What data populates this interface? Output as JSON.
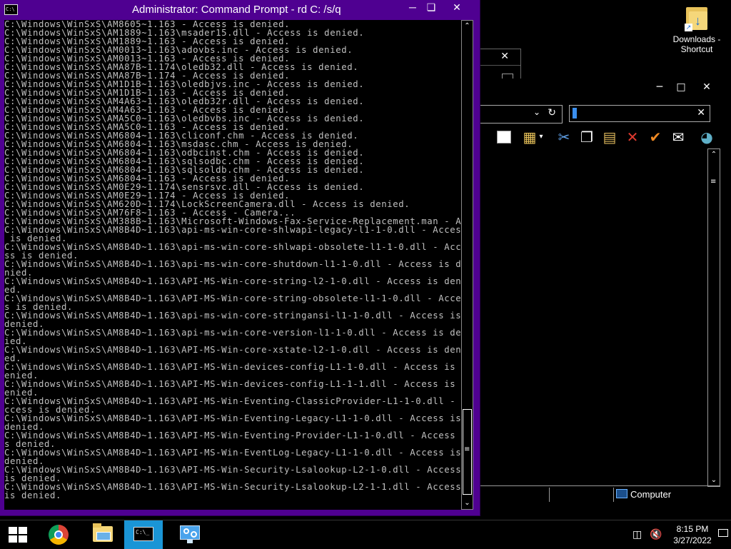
{
  "desktop": {
    "shortcut_label": "Downloads - Shortcut"
  },
  "cmd": {
    "title": "Administrator: Command Prompt - rd  C: /s/q",
    "app_icon_text": "C:\\",
    "lines": [
      "C:\\Windows\\WinSxS\\AM8605~1.163 - Access is denied.",
      "C:\\Windows\\WinSxS\\AM1889~1.163\\msader15.dll - Access is denied.",
      "C:\\Windows\\WinSxS\\AM1889~1.163 - Access is denied.",
      "C:\\Windows\\WinSxS\\AM0013~1.163\\adovbs.inc - Access is denied.",
      "C:\\Windows\\WinSxS\\AM0013~1.163 - Access is denied.",
      "C:\\Windows\\WinSxS\\AMA87B~1.174\\oledb32.dll - Access is denied.",
      "C:\\Windows\\WinSxS\\AMA87B~1.174 - Access is denied.",
      "C:\\Windows\\WinSxS\\AM1D1B~1.163\\oledbjvs.inc - Access is denied.",
      "C:\\Windows\\WinSxS\\AM1D1B~1.163 - Access is denied.",
      "C:\\Windows\\WinSxS\\AM4A63~1.163\\oledb32r.dll - Access is denied.",
      "C:\\Windows\\WinSxS\\AM4A63~1.163 - Access is denied.",
      "C:\\Windows\\WinSxS\\AMA5C0~1.163\\oledbvbs.inc - Access is denied.",
      "C:\\Windows\\WinSxS\\AMA5C0~1.163 - Access is denied.",
      "C:\\Windows\\WinSxS\\AM6804~1.163\\cliconf.chm - Access is denied.",
      "C:\\Windows\\WinSxS\\AM6804~1.163\\msdasc.chm - Access is denied.",
      "C:\\Windows\\WinSxS\\AM6804~1.163\\odbcinst.chm - Access is denied.",
      "C:\\Windows\\WinSxS\\AM6804~1.163\\sqlsodbc.chm - Access is denied.",
      "C:\\Windows\\WinSxS\\AM6804~1.163\\sqlsoldb.chm - Access is denied.",
      "C:\\Windows\\WinSxS\\AM6804~1.163 - Access is denied.",
      "C:\\Windows\\WinSxS\\AM0E29~1.174\\sensrsvc.dll - Access is denied.",
      "C:\\Windows\\WinSxS\\AM0E29~1.174 - Access is denied.",
      "C:\\Windows\\WinSxS\\AM620D~1.174\\LockScreenCamera.dll - Access is denied.",
      "C:\\Windows\\WinSxS\\AM76F8~1.163 - Access - Camera...",
      "C:\\Windows\\WinSxS\\AM388B~1.163\\Microsoft-Windows-Fax-Service-Replacement.man - Ac",
      "C:\\Windows\\WinSxS\\AM8B4D~1.163\\api-ms-win-core-shlwapi-legacy-l1-1-0.dll - Access",
      " is denied.",
      "C:\\Windows\\WinSxS\\AM8B4D~1.163\\api-ms-win-core-shlwapi-obsolete-l1-1-0.dll - Acce",
      "ss is denied.",
      "C:\\Windows\\WinSxS\\AM8B4D~1.163\\api-ms-win-core-shutdown-l1-1-0.dll - Access is de",
      "nied.",
      "C:\\Windows\\WinSxS\\AM8B4D~1.163\\API-MS-Win-core-string-l2-1-0.dll - Access is deni",
      "ed.",
      "C:\\Windows\\WinSxS\\AM8B4D~1.163\\API-MS-Win-core-string-obsolete-l1-1-0.dll - Acces",
      "s is denied.",
      "C:\\Windows\\WinSxS\\AM8B4D~1.163\\api-ms-win-core-stringansi-l1-1-0.dll - Access is",
      "denied.",
      "C:\\Windows\\WinSxS\\AM8B4D~1.163\\api-ms-win-core-version-l1-1-0.dll - Access is den",
      "ied.",
      "C:\\Windows\\WinSxS\\AM8B4D~1.163\\API-MS-Win-core-xstate-l2-1-0.dll - Access is deni",
      "ed.",
      "C:\\Windows\\WinSxS\\AM8B4D~1.163\\API-MS-Win-devices-config-L1-1-0.dll - Access is d",
      "enied.",
      "C:\\Windows\\WinSxS\\AM8B4D~1.163\\API-MS-Win-devices-config-L1-1-1.dll - Access is d",
      "enied.",
      "C:\\Windows\\WinSxS\\AM8B4D~1.163\\API-MS-Win-Eventing-ClassicProvider-L1-1-0.dll - A",
      "ccess is denied.",
      "C:\\Windows\\WinSxS\\AM8B4D~1.163\\API-MS-Win-Eventing-Legacy-L1-1-0.dll - Access is",
      "denied.",
      "C:\\Windows\\WinSxS\\AM8B4D~1.163\\API-MS-Win-Eventing-Provider-L1-1-0.dll - Access i",
      "s denied.",
      "C:\\Windows\\WinSxS\\AM8B4D~1.163\\API-MS-Win-EventLog-Legacy-L1-1-0.dll - Access is",
      "denied.",
      "C:\\Windows\\WinSxS\\AM8B4D~1.163\\API-MS-Win-Security-Lsalookup-L2-1-0.dll - Access",
      "is denied.",
      "C:\\Windows\\WinSxS\\AM8B4D~1.163\\API-MS-Win-Security-Lsalookup-L2-1-1.dll - Access",
      "is denied."
    ]
  },
  "explorer": {
    "status_location": "Computer"
  },
  "taskbar": {
    "cmd_icon_text": "C:\\_",
    "time": "8:15 PM",
    "date": "3/27/2022"
  },
  "colors": {
    "cmd_frame": "#4f0091",
    "taskbar_active": "#1a95d6"
  }
}
